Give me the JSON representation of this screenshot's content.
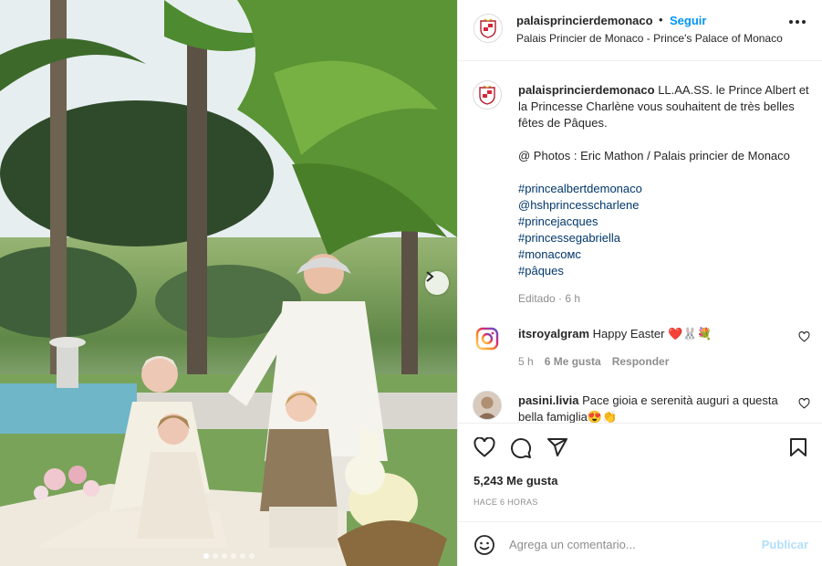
{
  "post": {
    "account": {
      "username": "palaisprincierdemonaco",
      "separator": "•",
      "follow_label": "Seguir",
      "location": "Palais Princier de Monaco - Prince's Palace of Monaco",
      "avatar_icon": "monaco-crest-icon"
    },
    "caption": {
      "username": "palaisprincierdemonaco",
      "text": "LL.AA.SS. le Prince Albert et la Princesse Charlène vous souhaitent de très belles fêtes de Pâques.",
      "credits": "@ Photos : Eric Mathon / Palais princier de Monaco",
      "hashtags": [
        "#princealbertdemonaco",
        "@hshprincesscharlene",
        "#princejacques",
        "#princessegabriella",
        "#monacoмс",
        "#pâques"
      ],
      "edited": "Editado · 6 h"
    },
    "comments": [
      {
        "username": "itsroyalgram",
        "text": "Happy Easter ❤️🐰💐",
        "time": "5 h",
        "likes": "6 Me gusta",
        "reply": "Responder",
        "avatar_icon": "instagram-logo-icon"
      },
      {
        "username": "pasini.livia",
        "text": "Pace gioia e serenità auguri a questa bella famiglia😍👏",
        "avatar_icon": "user-photo-icon"
      }
    ],
    "likes_count": "5,243 Me gusta",
    "posted_ago": "HACE 6 HORAS",
    "comment_box": {
      "placeholder": "Agrega un comentario...",
      "publish_label": "Publicar"
    },
    "carousel": {
      "current_slide": 1,
      "total_slides": 6
    }
  },
  "colors": {
    "accent_blue": "#0095f6",
    "publish_disabled": "#b2dffc",
    "hashtag": "#00376b",
    "muted": "#8e8e8e"
  }
}
